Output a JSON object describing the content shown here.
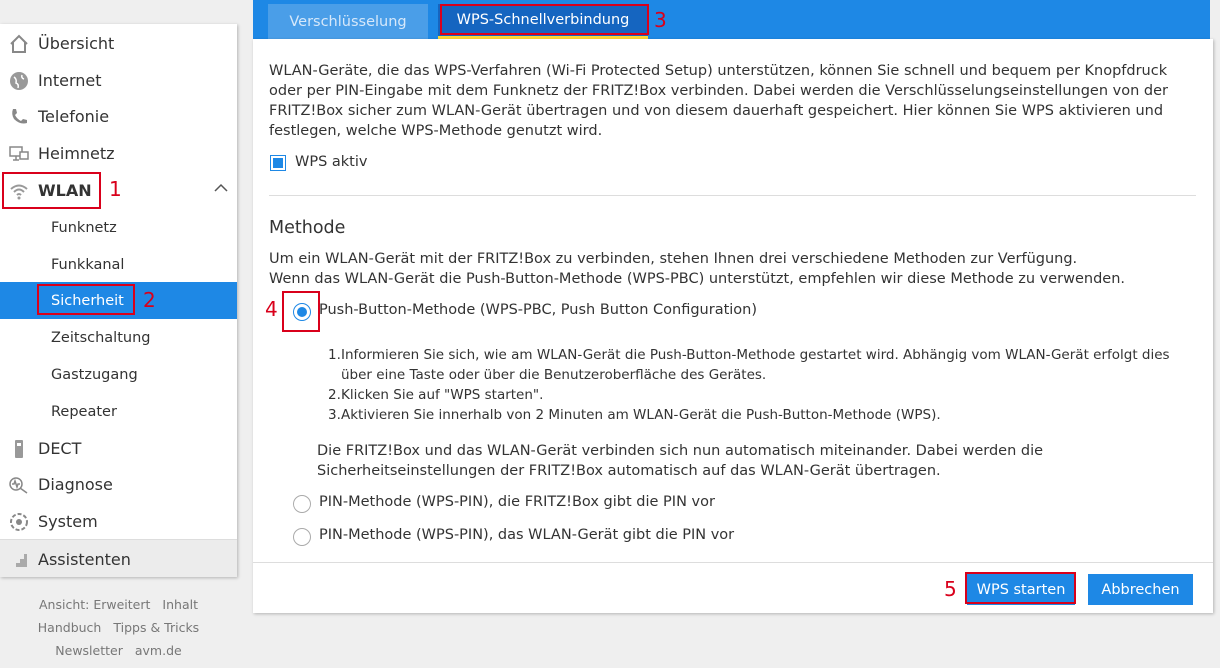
{
  "sidebar": {
    "items": [
      {
        "label": "Übersicht",
        "icon": "home-icon"
      },
      {
        "label": "Internet",
        "icon": "globe-icon"
      },
      {
        "label": "Telefonie",
        "icon": "phone-icon"
      },
      {
        "label": "Heimnetz",
        "icon": "network-icon"
      },
      {
        "label": "WLAN",
        "icon": "wifi-icon"
      },
      {
        "label": "DECT",
        "icon": "dect-phone-icon"
      },
      {
        "label": "Diagnose",
        "icon": "diagnosis-icon"
      },
      {
        "label": "System",
        "icon": "system-icon"
      },
      {
        "label": "Assistenten",
        "icon": "wizard-icon"
      }
    ],
    "wlan_sub": [
      "Funknetz",
      "Funkkanal",
      "Sicherheit",
      "Zeitschaltung",
      "Gastzugang",
      "Repeater"
    ],
    "active_sub": "Sicherheit"
  },
  "footer": {
    "links": [
      [
        "Ansicht: Erweitert",
        "Inhalt"
      ],
      [
        "Handbuch",
        "Tipps & Tricks"
      ],
      [
        "Newsletter",
        "avm.de"
      ]
    ]
  },
  "tabs": {
    "encryption": "Verschlüsselung",
    "wps": "WPS-Schnellverbindung"
  },
  "intro": "WLAN-Geräte, die das WPS-Verfahren (Wi-Fi Protected Setup) unterstützen, können Sie schnell und bequem per Knopfdruck oder per PIN-Eingabe mit dem Funknetz der FRITZ!Box verbinden. Dabei werden die Verschlüsselungseinstellungen von der FRITZ!Box sicher zum WLAN-Gerät übertragen und von diesem dauerhaft gespeichert. Hier können Sie WPS aktivieren und festlegen, welche WPS-Methode genutzt wird.",
  "wps_active": {
    "label": "WPS aktiv",
    "checked": true
  },
  "methode": {
    "title": "Methode",
    "desc_1": "Um ein WLAN-Gerät mit der FRITZ!Box zu verbinden, stehen Ihnen drei verschiedene Methoden zur Verfügung.",
    "desc_2": "Wenn das WLAN-Gerät die Push-Button-Methode (WPS-PBC) unterstützt, empfehlen wir diese Methode zu verwenden.",
    "options": [
      {
        "label": "Push-Button-Methode (WPS-PBC, Push Button Configuration)",
        "checked": true
      },
      {
        "label": "PIN-Methode (WPS-PIN), die FRITZ!Box gibt die PIN vor",
        "checked": false
      },
      {
        "label": "PIN-Methode (WPS-PIN), das WLAN-Gerät gibt die PIN vor",
        "checked": false
      }
    ],
    "steps": [
      {
        "num": "1.",
        "text": "Informieren Sie sich, wie am WLAN-Gerät die Push-Button-Methode gestartet wird. Abhängig vom WLAN-Gerät erfolgt dies über eine Taste oder über die Benutzeroberfläche des Gerätes."
      },
      {
        "num": "2.",
        "text": "Klicken Sie auf \"WPS starten\"."
      },
      {
        "num": "3.",
        "text": "Aktivieren Sie innerhalb von 2 Minuten am WLAN-Gerät die Push-Button-Methode (WPS)."
      }
    ],
    "result": "Die FRITZ!Box und das WLAN-Gerät verbinden sich nun automatisch miteinander. Dabei werden die Sicherheitseinstellungen der FRITZ!Box automatisch auf das WLAN-Gerät übertragen."
  },
  "buttons": {
    "start": "WPS starten",
    "cancel": "Abbrechen"
  },
  "annotations": [
    "1",
    "2",
    "3",
    "4",
    "5"
  ],
  "colors": {
    "accent": "#1e88e5",
    "annotation": "#d9001b"
  }
}
